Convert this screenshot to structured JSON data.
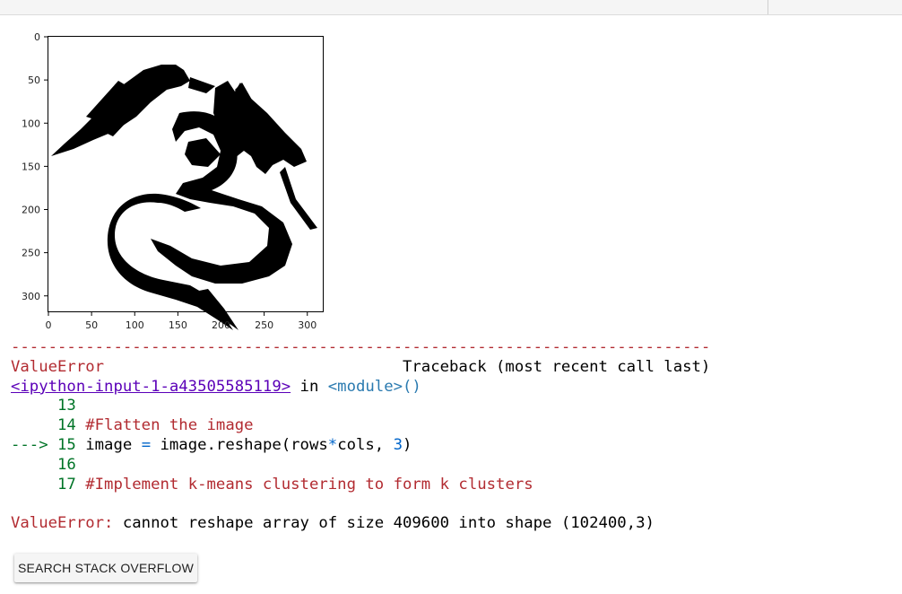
{
  "plot": {
    "x_ticks": [
      "0",
      "50",
      "100",
      "150",
      "200",
      "250",
      "300"
    ],
    "y_ticks": [
      "0",
      "50",
      "100",
      "150",
      "200",
      "250",
      "300"
    ],
    "image_content": "dragon-silhouette"
  },
  "traceback": {
    "separator": "---------------------------------------------------------------------------",
    "error_type": "ValueError",
    "header_right": "Traceback (most recent call last)",
    "input_link": "<ipython-input-1-a43505585119>",
    "in_word": "in",
    "module": "<module>()",
    "lines": [
      {
        "marker": "     ",
        "num": "13",
        "code": ""
      },
      {
        "marker": "     ",
        "num": "14",
        "code": "#Flatten the image"
      },
      {
        "marker": "---> ",
        "num": "15",
        "code": "image = image.reshape(rows*cols, 3)"
      },
      {
        "marker": "     ",
        "num": "16",
        "code": ""
      },
      {
        "marker": "     ",
        "num": "17",
        "code": "#Implement k-means clustering to form k clusters"
      }
    ],
    "final_error_type": "ValueError:",
    "final_message": "cannot reshape array of size 409600 into shape (102400,3)"
  },
  "stack_overflow_button": "SEARCH STACK OVERFLOW",
  "colors": {
    "error": "#b22b31",
    "lineno": "#007427",
    "keyword_blue": "#0065ca",
    "link": "#5b00b8"
  }
}
